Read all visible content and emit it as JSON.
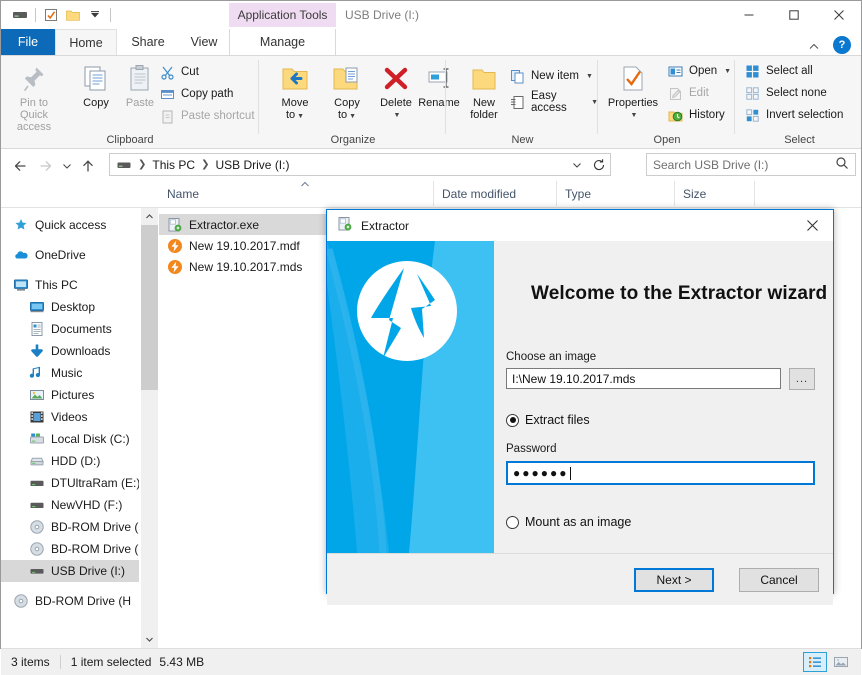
{
  "window": {
    "title": "USB Drive (I:)",
    "contextual_tab": "Application Tools",
    "minimize": "—",
    "maximize": "□",
    "close": "✕"
  },
  "quick_access": [
    {
      "name": "drive-icon",
      "glyph": "drive"
    },
    {
      "name": "properties-icon",
      "glyph": "checkbox"
    },
    {
      "name": "new-folder-icon",
      "glyph": "folder"
    },
    {
      "name": "customize-dropdown-icon",
      "glyph": "chevron-down"
    }
  ],
  "tabs": [
    {
      "id": "file",
      "label": "File"
    },
    {
      "id": "home",
      "label": "Home"
    },
    {
      "id": "share",
      "label": "Share"
    },
    {
      "id": "view",
      "label": "View"
    },
    {
      "id": "manage",
      "label": "Manage"
    }
  ],
  "ribbon": {
    "help_icon": "?",
    "collapse_icon": "^",
    "groups": [
      {
        "label": "Clipboard"
      },
      {
        "label": "Organize"
      },
      {
        "label": "New"
      },
      {
        "label": "Open"
      },
      {
        "label": "Select"
      }
    ],
    "clipboard": {
      "pin": "Pin to Quick\naccess",
      "pin_l1": "Pin to Quick",
      "pin_l2": "access",
      "copy": "Copy",
      "paste": "Paste",
      "cut": "Cut",
      "copy_path": "Copy path",
      "paste_shortcut": "Paste shortcut"
    },
    "organize": {
      "move_to_l1": "Move",
      "move_to_l2": "to",
      "copy_to_l1": "Copy",
      "copy_to_l2": "to",
      "delete": "Delete",
      "rename": "Rename"
    },
    "new": {
      "new_folder_l1": "New",
      "new_folder_l2": "folder",
      "new_item": "New item",
      "easy_access": "Easy access"
    },
    "open_group": {
      "properties": "Properties",
      "open": "Open",
      "edit": "Edit",
      "history": "History"
    },
    "select": {
      "select_all": "Select all",
      "select_none": "Select none",
      "invert_selection": "Invert selection"
    }
  },
  "nav": {
    "back": "←",
    "forward": "→",
    "recent": "˅",
    "up": "↑",
    "refresh": "↻",
    "dropdown": "˅",
    "breadcrumb": [
      "This PC",
      "USB Drive (I:)"
    ],
    "search_placeholder": "Search USB Drive (I:)"
  },
  "columns": [
    {
      "label": "Name",
      "sorted": true
    },
    {
      "label": "Date modified",
      "sorted": false
    },
    {
      "label": "Type",
      "sorted": false
    },
    {
      "label": "Size",
      "sorted": false
    }
  ],
  "sidebar": {
    "items": [
      {
        "label": "Quick access",
        "icon": "star-icon",
        "indent": 0,
        "selected": false
      },
      {
        "label": "OneDrive",
        "icon": "cloud-icon",
        "indent": 0,
        "selected": false
      },
      {
        "label": "This PC",
        "icon": "monitor-icon",
        "indent": 0,
        "selected": false
      },
      {
        "label": "Desktop",
        "icon": "desktop-icon",
        "indent": 1,
        "selected": false
      },
      {
        "label": "Documents",
        "icon": "documents-icon",
        "indent": 1,
        "selected": false
      },
      {
        "label": "Downloads",
        "icon": "downloads-icon",
        "indent": 1,
        "selected": false
      },
      {
        "label": "Music",
        "icon": "music-icon",
        "indent": 1,
        "selected": false
      },
      {
        "label": "Pictures",
        "icon": "pictures-icon",
        "indent": 1,
        "selected": false
      },
      {
        "label": "Videos",
        "icon": "videos-icon",
        "indent": 1,
        "selected": false
      },
      {
        "label": "Local Disk (C:)",
        "icon": "system-drive-icon",
        "indent": 1,
        "selected": false
      },
      {
        "label": "HDD (D:)",
        "icon": "hdd-icon",
        "indent": 1,
        "selected": false
      },
      {
        "label": "DTUltraRam (E:)",
        "icon": "drive-icon",
        "indent": 1,
        "selected": false
      },
      {
        "label": "NewVHD (F:)",
        "icon": "drive-icon",
        "indent": 1,
        "selected": false
      },
      {
        "label": "BD-ROM Drive (",
        "icon": "disc-icon",
        "indent": 1,
        "selected": false
      },
      {
        "label": "BD-ROM Drive (",
        "icon": "disc-icon",
        "indent": 1,
        "selected": false
      },
      {
        "label": "USB Drive (I:)",
        "icon": "usb-drive-icon",
        "indent": 1,
        "selected": true
      },
      {
        "label": "BD-ROM Drive (H",
        "icon": "disc-icon",
        "indent": 0,
        "selected": false
      }
    ]
  },
  "files": [
    {
      "name": "Extractor.exe",
      "icon": "exe-icon",
      "selected": true
    },
    {
      "name": "New 19.10.2017.mdf",
      "icon": "daemon-image-icon",
      "selected": false
    },
    {
      "name": "New 19.10.2017.mds",
      "icon": "daemon-image-icon",
      "selected": false
    }
  ],
  "status": {
    "items_count": "3 items",
    "selection": "1 item selected",
    "size": "5.43 MB"
  },
  "view_buttons": [
    {
      "name": "details-view-button",
      "active": true
    },
    {
      "name": "large-icons-view-button",
      "active": false
    }
  ],
  "dialog": {
    "title": "Extractor",
    "close": "✕",
    "heading": "Welcome to the Extractor wizard",
    "image_label": "Choose an image",
    "image_value": "I:\\New 19.10.2017.mds",
    "browse_label": "...",
    "option_extract": "Extract files",
    "option_mount": "Mount as an image",
    "password_label": "Password",
    "password_value": "●●●●●●",
    "next_label": "Next >",
    "cancel_label": "Cancel"
  },
  "colors": {
    "accent": "#0078d7",
    "file_tab": "#0d6ab8",
    "contextual_tab": "#f0dcf2",
    "banner_blue": "#00a2e8",
    "banner_blue_light": "#3dbef0",
    "selection_gray": "#d9d9d9"
  }
}
